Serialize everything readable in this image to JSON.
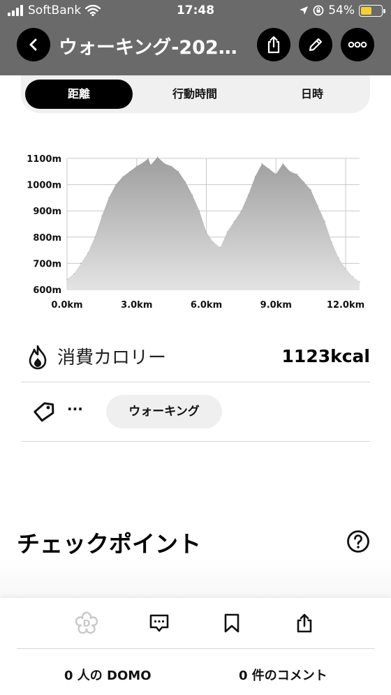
{
  "status_bar": {
    "carrier": "SoftBank",
    "time": "17:48",
    "battery": "54%",
    "battery_level": 0.54,
    "signal_icon": "signal-bars-icon",
    "wifi_icon": "wifi-icon",
    "location_icon": "location-arrow-icon",
    "lock_icon": "orientation-lock-icon"
  },
  "nav": {
    "title": "ウォーキング-202…",
    "back_icon": "chevron-left-icon",
    "share_icon": "share-icon",
    "edit_icon": "pencil-icon",
    "more_icon": "more-icon"
  },
  "tabs": [
    {
      "label": "距離",
      "active": true
    },
    {
      "label": "行動時間",
      "active": false
    },
    {
      "label": "日時",
      "active": false
    }
  ],
  "chart_data": {
    "type": "area",
    "title": "",
    "xlabel": "",
    "ylabel": "",
    "x_ticks": [
      "0.0km",
      "3.0km",
      "6.0km",
      "9.0km",
      "12.0km"
    ],
    "y_ticks": [
      "1100m",
      "1000m",
      "900m",
      "800m",
      "700m",
      "600m"
    ],
    "xlim": [
      0,
      12.6
    ],
    "ylim": [
      600,
      1100
    ],
    "grid": true,
    "series": [
      {
        "x": [
          0.0,
          0.3,
          0.6,
          0.9,
          1.2,
          1.5,
          1.8,
          2.1,
          2.4,
          2.7,
          3.0,
          3.3,
          3.5,
          3.6,
          3.9,
          4.2,
          4.5,
          4.8,
          5.1,
          5.4,
          5.7,
          6.0,
          6.3,
          6.6,
          6.9,
          7.2,
          7.5,
          7.8,
          8.1,
          8.4,
          8.7,
          9.0,
          9.3,
          9.6,
          9.9,
          10.2,
          10.5,
          10.8,
          11.1,
          11.4,
          11.7,
          12.0,
          12.3,
          12.6
        ],
        "values": [
          640,
          660,
          700,
          740,
          800,
          880,
          950,
          1000,
          1030,
          1050,
          1070,
          1085,
          1100,
          1075,
          1105,
          1080,
          1070,
          1050,
          1010,
          960,
          900,
          820,
          780,
          760,
          820,
          860,
          900,
          960,
          1030,
          1080,
          1060,
          1040,
          1080,
          1050,
          1040,
          1010,
          980,
          920,
          860,
          780,
          720,
          680,
          650,
          630
        ]
      }
    ],
    "colors": {
      "fill_top": "#9e9e9e",
      "fill_bottom": "#e3e3e3",
      "grid": "#c8c8c8"
    }
  },
  "calories": {
    "label": "消費カロリー",
    "value": "1123kcal",
    "icon": "flame-icon"
  },
  "tag": {
    "icon": "tag-icon",
    "more": "···",
    "chip": "ウォーキング"
  },
  "checkpoint": {
    "title": "チェックポイント",
    "help_icon": "question-circle-icon"
  },
  "bottom": {
    "domo_icon": "domo-flower-icon",
    "comment_icon": "comment-icon",
    "bookmark_icon": "bookmark-icon",
    "share_icon": "share-icon",
    "domo_count": "0 人の DOMO",
    "comment_count": "0 件のコメント"
  },
  "colors": {
    "header_bg": "#6a6a6a",
    "accent": "#000000",
    "battery": "#f5d033"
  }
}
